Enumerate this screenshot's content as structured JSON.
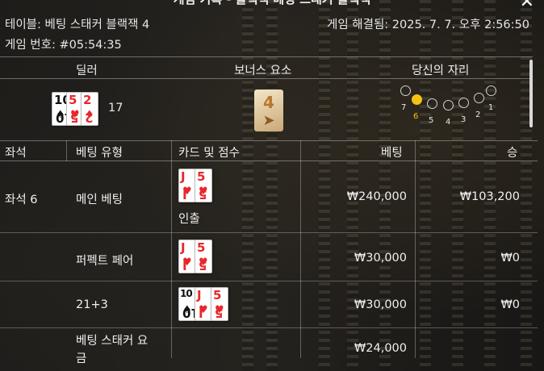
{
  "window": {
    "title": "게임 기록 - 블랙잭 베팅 스태커 블랙잭",
    "close_glyph": "✕"
  },
  "meta": {
    "table": "테이블: 베팅 스태커 블랙잭 4",
    "resolved": "게임 해결됨: 2025. 7. 7. 오후 2:56:50",
    "game_no": "게임 번호: #05:54:35"
  },
  "sections": {
    "dealer": "딜러",
    "bonus": "보너스 요소",
    "your_seat": "당신의 자리"
  },
  "dealer": {
    "cards": [
      {
        "rank": "10",
        "suit": "♠",
        "color": "black"
      },
      {
        "rank": "5",
        "suit": "♥",
        "color": "red"
      },
      {
        "rank": "2",
        "suit": "♦",
        "color": "red"
      }
    ],
    "score": "17"
  },
  "bonus": {
    "multiplier": "4",
    "arrow": "➤"
  },
  "seats": {
    "labels": [
      "7",
      "6",
      "5",
      "4",
      "3",
      "2",
      "1"
    ],
    "active": "6"
  },
  "table": {
    "headers": {
      "seat": "좌석",
      "bet_type": "베팅 유형",
      "cards_score": "카드 및 점수",
      "bet": "베팅",
      "win": "승"
    },
    "seat_label": "좌석 6",
    "rows": [
      {
        "bet_type": "메인 베팅",
        "note": "인출",
        "bet": "₩240,000",
        "win": "₩103,200",
        "cards": [
          {
            "rank": "J",
            "suit": "♥",
            "color": "red"
          },
          {
            "rank": "5",
            "suit": "♥",
            "color": "red"
          }
        ]
      },
      {
        "bet_type": "퍼펙트 페어",
        "note": "",
        "bet": "₩30,000",
        "win": "₩0",
        "cards": [
          {
            "rank": "J",
            "suit": "♥",
            "color": "red"
          },
          {
            "rank": "5",
            "suit": "♥",
            "color": "red"
          }
        ]
      },
      {
        "bet_type": "21+3",
        "note": "",
        "bet": "₩30,000",
        "win": "₩0",
        "cards": [
          {
            "rank": "10",
            "suit": "♠",
            "color": "black"
          },
          {
            "rank": "J",
            "suit": "♥",
            "color": "red"
          },
          {
            "rank": "5",
            "suit": "♥",
            "color": "red"
          }
        ]
      },
      {
        "bet_type": "베팅 스태커 요\n금",
        "note": "",
        "bet": "₩24,000",
        "win": "",
        "cards": []
      }
    ]
  },
  "colors": {
    "accent_seat": "#f2c314",
    "card_red": "#e8262c"
  }
}
